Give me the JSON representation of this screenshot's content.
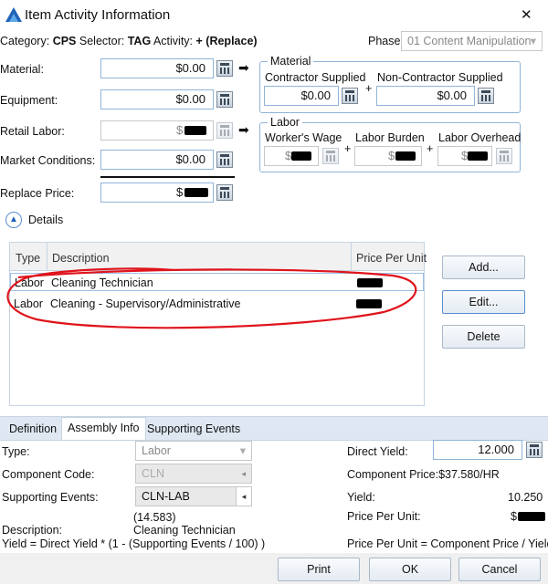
{
  "window": {
    "title": "Item Activity Information",
    "close_glyph": "✕"
  },
  "header": {
    "category_label": "Category:",
    "category_value": "CPS",
    "selector_label": "Selector:",
    "selector_value": "TAG",
    "activity_label": "Activity:",
    "activity_value": "+ (Replace)",
    "phase_label": "Phase:",
    "phase_value": "01 Content Manipulation"
  },
  "fields": {
    "material": {
      "label": "Material:",
      "value": "$0.00"
    },
    "equipment": {
      "label": "Equipment:",
      "value": "$0.00"
    },
    "retail_labor": {
      "label": "Retail Labor:",
      "value": "$"
    },
    "market_conditions": {
      "label": "Market Conditions:",
      "value": "$0.00"
    },
    "replace_price": {
      "label": "Replace Price:",
      "value": "$"
    }
  },
  "material_group": {
    "title": "Material",
    "contractor_label": "Contractor Supplied",
    "contractor_value": "$0.00",
    "noncontractor_label": "Non-Contractor Supplied",
    "noncontractor_value": "$0.00",
    "plus": "+"
  },
  "labor_group": {
    "title": "Labor",
    "wage_label": "Worker's Wage",
    "wage_value": "$",
    "burden_label": "Labor Burden",
    "burden_value": "$",
    "overhead_label": "Labor Overhead",
    "overhead_value": "$",
    "plus": "+"
  },
  "details": {
    "label": "Details"
  },
  "table": {
    "columns": [
      "Type",
      "Description",
      "Price Per Unit"
    ],
    "rows": [
      {
        "type": "Labor",
        "description": "Cleaning Technician"
      },
      {
        "type": "Labor",
        "description": "Cleaning - Supervisory/Administrative"
      }
    ]
  },
  "side_buttons": {
    "add": "Add...",
    "edit": "Edit...",
    "delete": "Delete"
  },
  "tabs": [
    "Definition",
    "Assembly Info",
    "Supporting Events"
  ],
  "assembly": {
    "type_label": "Type:",
    "type_value": "Labor",
    "component_code_label": "Component Code:",
    "component_code_value": "CLN",
    "supporting_events_label": "Supporting Events:",
    "supporting_events_value": "CLN-LAB",
    "supporting_events_sub": "(14.583)",
    "description_label": "Description:",
    "description_value": "Cleaning Technician",
    "formula_left": "Yield = Direct Yield * (1 - (Supporting Events / 100) )",
    "direct_yield_label": "Direct Yield:",
    "direct_yield_value": "12.000",
    "component_price_label": "Component Price:",
    "component_price_value": "$37.580/HR",
    "yield_label": "Yield:",
    "yield_value": "10.250",
    "price_per_unit_label": "Price Per Unit:",
    "price_per_unit_value": "$",
    "formula_right": "Price Per Unit = Component Price / Yield"
  },
  "footer": {
    "print": "Print",
    "ok": "OK",
    "cancel": "Cancel"
  },
  "colors": {
    "annotation": "#e0141c",
    "accent_border": "#8fb4d9",
    "tab_strip": "#dfe8f2"
  }
}
